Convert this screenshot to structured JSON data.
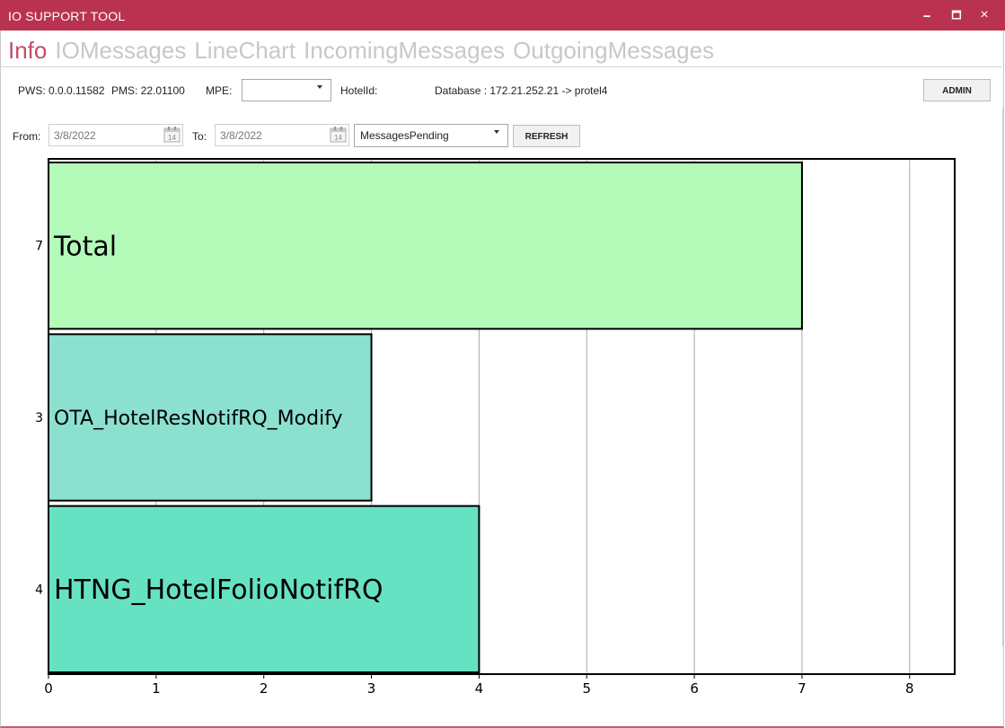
{
  "window": {
    "title": "IO SUPPORT TOOL",
    "controls": {
      "minimize": "🗕",
      "maximize": "🗖",
      "close": "×"
    }
  },
  "tabs": [
    {
      "label": "Info",
      "active": true
    },
    {
      "label": "IOMessages",
      "active": false
    },
    {
      "label": "LineChart",
      "active": false
    },
    {
      "label": "IncomingMessages",
      "active": false
    },
    {
      "label": "OutgoingMessages",
      "active": false
    }
  ],
  "info_bar": {
    "pws": "PWS: 0.0.0.11582",
    "pms": "PMS: 22.01100",
    "mpe_label": "MPE:",
    "mpe_value": "",
    "hotel_id_label": "HotelId:",
    "database": "Database : 172.21.252.21 -> protel4",
    "admin_button": "ADMIN"
  },
  "filter_bar": {
    "from_label": "From:",
    "from_value": "3/8/2022",
    "to_label": "To:",
    "to_value": "3/8/2022",
    "calendar_day": "14",
    "report_select": "MessagesPending",
    "refresh_button": "REFRESH"
  },
  "colors": {
    "titlebar": "#b93350",
    "active_tab": "#c14e66",
    "inactive_tab": "#c8c8c8",
    "bar_total": "#b3f9b8",
    "bar_ota": "#8ce0d0",
    "bar_htng": "#66e2c3"
  },
  "chart_data": {
    "type": "bar",
    "orientation": "horizontal",
    "bars": [
      {
        "label": "Total",
        "value": 7,
        "value_label": "7",
        "color": "#b3f9b8"
      },
      {
        "label": "OTA_HotelResNotifRQ_Modify",
        "value": 3,
        "value_label": "3",
        "color": "#8ce0d0"
      },
      {
        "label": "HTNG_HotelFolioNotifRQ",
        "value": 4,
        "value_label": "4",
        "color": "#66e2c3"
      }
    ],
    "x_ticks": [
      "0",
      "1",
      "2",
      "3",
      "4",
      "5",
      "6",
      "7",
      "8"
    ],
    "xlim": [
      0,
      8.43
    ],
    "grid": true
  }
}
